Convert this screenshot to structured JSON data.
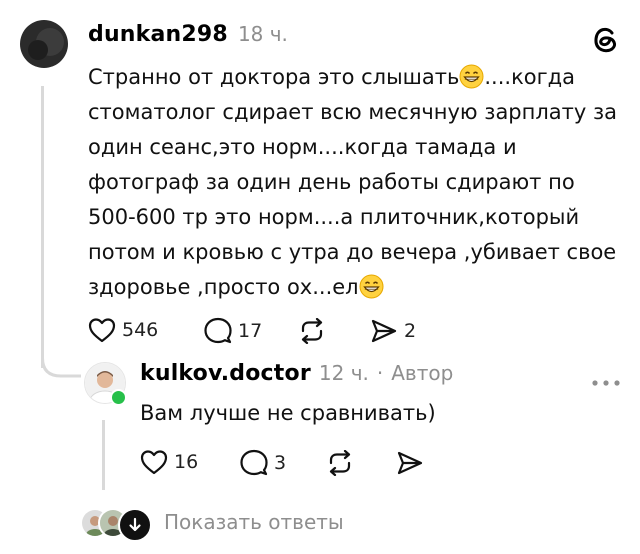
{
  "comment": {
    "username": "dunkan298",
    "time": "18 ч.",
    "text_parts": [
      "Странно от доктора это слышать",
      "....когда стоматолог сдирает всю месячную зарплату за один сеанс,это норм....когда тамада и фотограф за один день работы сдирают по 500-600 тр это норм....а плиточник,который потом и кровью с утра до вечера ,убивает свое здоровье ,просто ох...ел"
    ],
    "likes": "546",
    "replies": "17"
  },
  "reply": {
    "username": "kulkov.doctor",
    "time": "12 ч.",
    "separator": "·",
    "author_badge": "Автор",
    "text": "Вам лучше не сравнивать)",
    "likes": "16",
    "replies": "3"
  },
  "footer": {
    "show_replies": "Показать ответы"
  },
  "icons": {
    "app": "threads-icon",
    "like": "heart-icon",
    "comment": "comment-icon",
    "repost": "repost-icon",
    "share": "share-icon",
    "more": "more-icon",
    "emoji": "grinning-emoji-icon"
  },
  "colors": {
    "online": "#27c04a",
    "muted": "#8e8e8e",
    "thread_line": "#d9d9d9"
  }
}
